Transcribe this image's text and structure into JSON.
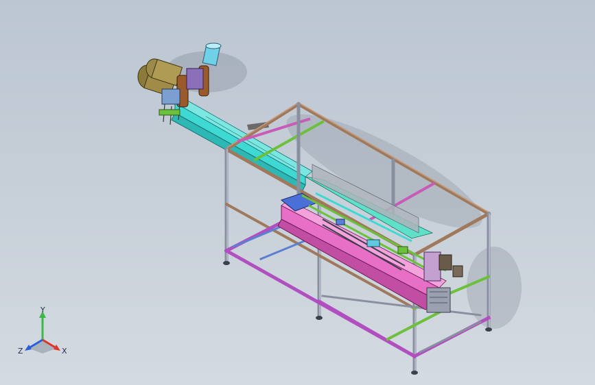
{
  "viewport": {
    "background_top": "#bcc6d1",
    "background_bottom": "#d4dae1"
  },
  "triad": {
    "x_label": "X",
    "y_label": "Y",
    "z_label": "Z",
    "x_color": "#e0352a",
    "y_color": "#3cb84a",
    "z_color": "#2a5fd6"
  },
  "colors": {
    "frame_top_rail": "#a0795c",
    "frame_magenta": "#b24fc0",
    "frame_green": "#6cc03c",
    "frame_blue": "#5b7fd1",
    "conveyor_cyan": "#3fd9d4",
    "bed_pink": "#e86fc6",
    "motor_olive": "#8a7a3a",
    "bracket_brown": "#9b5a2a"
  }
}
